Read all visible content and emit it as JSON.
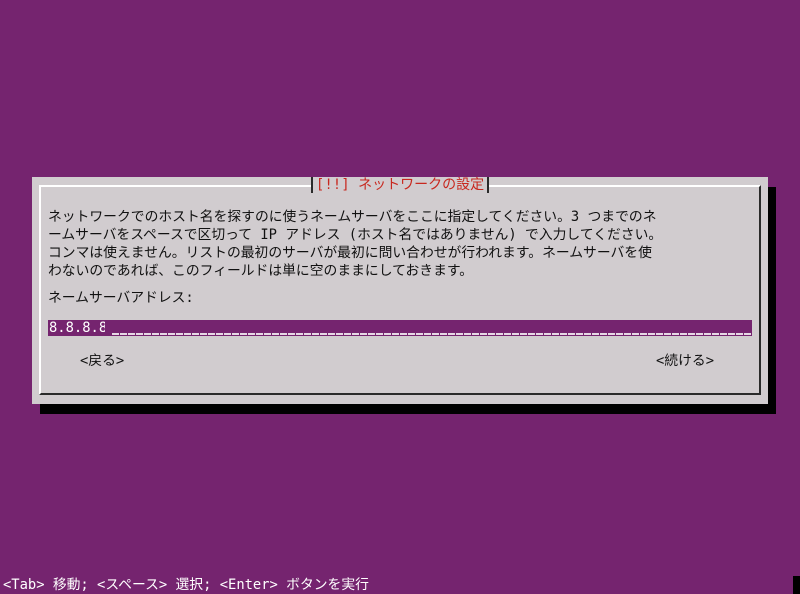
{
  "dialog": {
    "title": "[!!] ネットワークの設定",
    "description_lines": [
      "ネットワークでのホスト名を探すのに使うネームサーバをここに指定してください。3 つまでのネ",
      "ームサーバをスペースで区切って IP アドレス (ホスト名ではありません) で入力してください。",
      "コンマは使えません。リストの最初のサーバが最初に問い合わせが行われます。ネームサーバを使",
      "わないのであれば、このフィールドは単に空のままにしておきます。"
    ],
    "field_label": "ネームサーバアドレス:",
    "field_value": "8.8.8.8",
    "back_button": "<戻る>",
    "continue_button": "<続ける>"
  },
  "statusbar": {
    "text": "<Tab> 移動; <スペース> 選択; <Enter> ボタンを実行"
  },
  "colors": {
    "background": "#75246f",
    "dialog": "#d1cccf",
    "title_text": "#c8281f",
    "input_background": "#75246f"
  }
}
